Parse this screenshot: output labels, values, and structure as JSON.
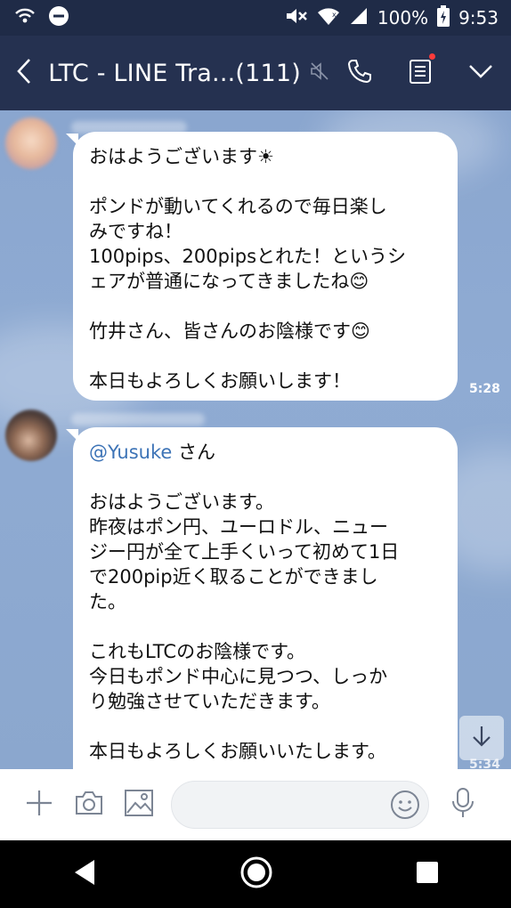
{
  "status_bar": {
    "battery": "100%",
    "time": "9:53"
  },
  "header": {
    "title": "LTC - LINE Tra...(111)"
  },
  "messages": [
    {
      "lines": [
        "おはようございます☀",
        "",
        "ポンドが動いてくれるので毎日楽し",
        "みですね！",
        "100pips、200pipsとれた！というシ",
        "ェアが普通になってきましたね😊",
        "",
        "竹井さん、皆さんのお陰様です😊",
        "",
        "本日もよろしくお願いします！"
      ],
      "time": "5:28"
    },
    {
      "mention": "@Yusuke",
      "mention_suffix": " さん",
      "lines": [
        "",
        "おはようございます。",
        "昨夜はポン円、ユーロドル、ニュー",
        "ジー円が全て上手くいって初めて1日",
        "で200pip近く取ることができまし",
        "た。",
        "",
        "これもLTCのお陰様です。",
        "今日もポンド中心に見つつ、しっか",
        "り勉強させていただきます。",
        "",
        "本日もよろしくお願いいたします。"
      ],
      "time": "5:34"
    }
  ],
  "input": {
    "placeholder": ""
  },
  "icons": {
    "back": "chevron-left-icon",
    "mute": "mute-icon",
    "call": "phone-icon",
    "notes": "notes-icon",
    "menu": "chevron-down-icon"
  }
}
